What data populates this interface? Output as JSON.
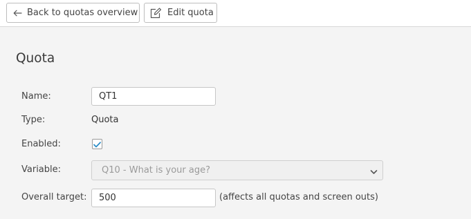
{
  "toolbar": {
    "back_label": "Back to quotas overview",
    "edit_label": "Edit quota"
  },
  "quota": {
    "title": "Quota",
    "name_label": "Name:",
    "name_value": "QT1",
    "type_label": "Type:",
    "type_value": "Quota",
    "enabled_label": "Enabled:",
    "enabled_checked": true,
    "variable_label": "Variable:",
    "variable_value": "Q10 - What is your age?",
    "target_label": "Overall target:",
    "target_value": "500",
    "target_hint": "(affects all quotas and screen outs)"
  },
  "colors": {
    "accent": "#2d8ec8",
    "page_background": "#f4f4f4",
    "toolbar_background": "#ffffff"
  },
  "icons": {
    "back": "arrow-left-icon",
    "edit": "edit-pencil-icon",
    "checked": "checkmark-icon",
    "dropdown": "chevron-down-icon"
  }
}
